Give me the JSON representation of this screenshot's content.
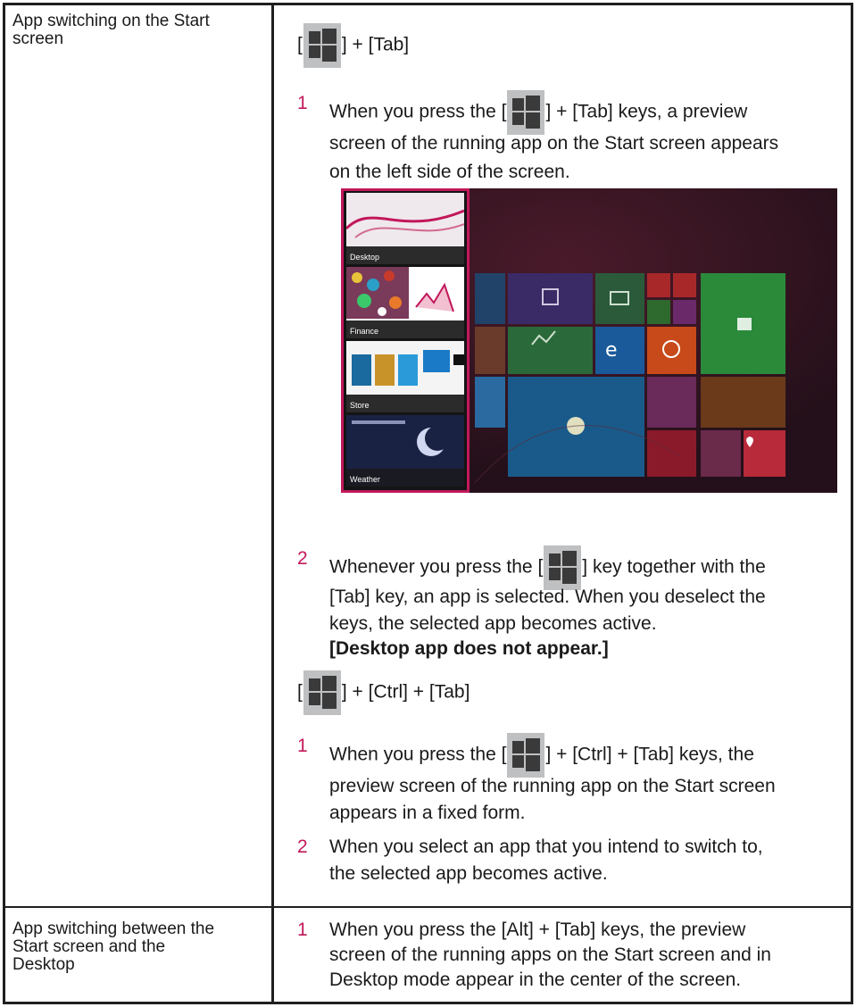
{
  "row1": {
    "heading": [
      "App switching on the Start",
      "screen"
    ],
    "shortcut1": {
      "open": "[",
      "rest": "] + [Tab]"
    },
    "step1": {
      "number": "1",
      "line1_pre": "When you press the [",
      "line1_post": "] + [Tab] keys, a preview",
      "line2": "screen of the running app on the Start screen appears",
      "line3": "on the left side of the screen."
    },
    "preview": {
      "apps": [
        "Desktop",
        "Finance",
        "Store",
        "Weather"
      ],
      "accent": "#c2185b"
    },
    "step2": {
      "number": "2",
      "line1_pre": "Whenever you press the [",
      "line1_post": "] key together with the",
      "line2": "[Tab] key, an app is selected. When you deselect the",
      "line3": "keys, the selected app becomes active.",
      "note": "[Desktop app does not appear.]"
    },
    "shortcut2": {
      "open": "[",
      "rest": "] + [Ctrl] + [Tab]"
    },
    "step3": {
      "number": "1",
      "line1_pre": "When you press the [",
      "line1_post": "] + [Ctrl] + [Tab] keys, the",
      "line2": "preview screen of the running app on the Start screen",
      "line3": "appears in a fixed form."
    },
    "step4": {
      "number": "2",
      "line1": "When you select an app that you intend to switch to,",
      "line2": "the selected app becomes active."
    }
  },
  "row2": {
    "heading": [
      "App switching between the",
      "Start screen and the",
      "Desktop"
    ],
    "step1": {
      "number": "1",
      "line1": "When you press the [Alt] + [Tab] keys, the preview",
      "line2": "screen of the running apps on the Start screen and in",
      "line3": "Desktop mode appear in the center of the screen."
    }
  },
  "icons": {
    "windows_key": "windows-logo-icon"
  }
}
